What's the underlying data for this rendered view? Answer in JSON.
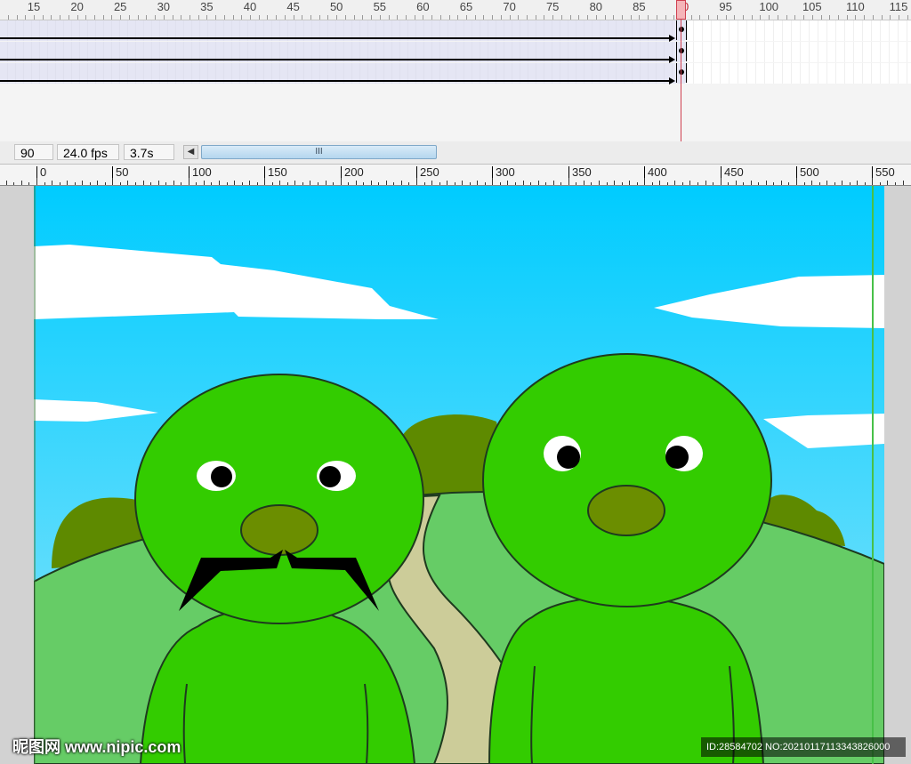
{
  "timeline": {
    "frame_numbers": [
      "15",
      "20",
      "25",
      "30",
      "35",
      "40",
      "45",
      "50",
      "55",
      "60",
      "65",
      "70",
      "75",
      "80",
      "85",
      "90",
      "95",
      "100",
      "105",
      "110",
      "115"
    ],
    "current_frame_marker": "90"
  },
  "status": {
    "current_frame": "90",
    "frame_rate": "24.0 fps",
    "elapsed_time": "3.7s",
    "scroll_thumb_grip": "III",
    "scroll_left_arrow": "◀"
  },
  "stage_ruler": {
    "labels": [
      "0",
      "50",
      "100",
      "150",
      "200",
      "250",
      "300",
      "350",
      "400",
      "450",
      "500",
      "550"
    ]
  },
  "colors": {
    "sky_top": "#00ccff",
    "sky_bottom": "#8ae4fb",
    "character_green": "#33cc00",
    "nose_olive": "#6b8e00",
    "hill_green": "#66cc66",
    "path_tan": "#cccc99",
    "tree_olive": "#5e8a00",
    "playhead": "#d04050"
  },
  "icons": [
    "scroll-left-arrow-icon",
    "scroll-grip-icon"
  ],
  "watermark": {
    "site": "昵图网 www.nipic.com",
    "id_text": "ID:28584702 NO:20210117113343826000"
  }
}
